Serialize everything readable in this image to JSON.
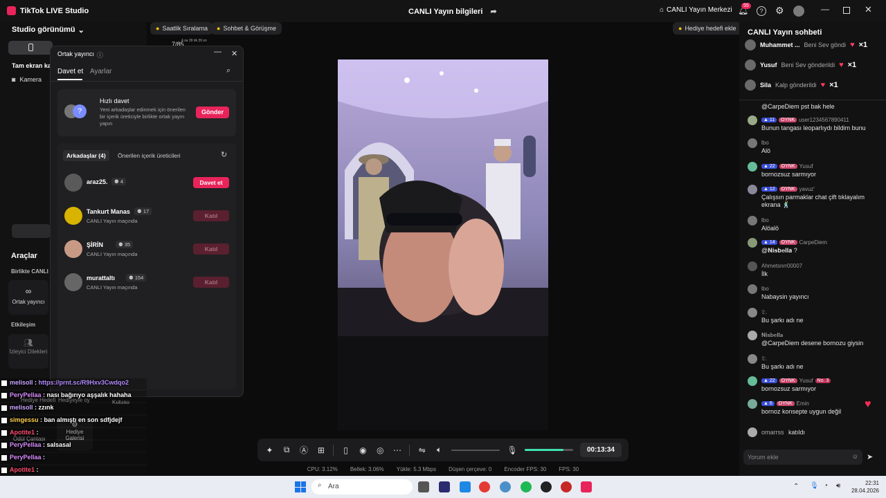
{
  "app": {
    "title": "TikTok LIVE Studio"
  },
  "header": {
    "center_title": "CANLI Yayın bilgileri",
    "live_center": "CANLI Yayın Merkezi",
    "notif_count": "55"
  },
  "left": {
    "view_label": "Studio görünümü",
    "fullscreen_label": "Tam ekran ka",
    "camera_label": "Kamera",
    "tools_title": "Araçlar",
    "together_label": "Birlikte CANLI",
    "cohost_label": "Ortak yayıncı",
    "interaction_label": "Etkileşim",
    "viewer_requests": "İzleyici Dilekleri",
    "tool_gift_goal": "Hediye Hedefi",
    "tool_gift_vote": "Hediyeyle oy",
    "tool_box": "Kutusu",
    "tool_reward_bag": "Ödül Çantası",
    "tool_gift_gallery_1": "Hediye",
    "tool_gift_gallery_2": "Galerisi"
  },
  "stage": {
    "tab_ranking": "Saatlik Sıralama",
    "tab_chat": "Sohbet & Görüşme",
    "counter": "7/85",
    "counter_sub": "4 sa 39 dk 39 sn",
    "gift_goal_button": "Hediye hedefi ekle",
    "timer": "00:13:34",
    "volume_level": 0.8
  },
  "status": {
    "cpu": "CPU:  3.12%",
    "memory": "Bellek:  3.06%",
    "upload": "Yükle:  5.3 Mbps",
    "dropped": "Düşen çerçeve:  0",
    "encoder": "Encoder FPS:  30",
    "fps": "FPS:  30"
  },
  "dialog": {
    "title": "Ortak yayıncı",
    "tab_invite": "Davet et",
    "tab_settings": "Ayarlar",
    "quick_title": "Hızlı davet",
    "quick_desc": "Yeni arkadaşlar edinmek için önerilen bir içerik üreticiyle birlikte ortak yayın yapın",
    "send_button": "Gönder",
    "friends_tab": "Arkadaşlar (4)",
    "suggested_tab": "Önerilen içerik üreticileri",
    "friends": [
      {
        "name": "araz25.",
        "count": "4",
        "sub": "",
        "button": "Davet et"
      },
      {
        "name": "Tankurt Manas",
        "count": "17",
        "sub": "CANLI Yayın maçında",
        "button": "Katıl"
      },
      {
        "name": "ŞİRİN",
        "count": "35",
        "sub": "CANLI Yayın maçında",
        "button": "Katıl"
      },
      {
        "name": "murattaltı",
        "count": "154",
        "sub": "CANLI Yayın maçında",
        "button": "Katıl"
      }
    ]
  },
  "overlay_chat": [
    {
      "user": "melisoll",
      "sep": " : ",
      "text": "https://prnt.sc/R9Hxv3Cwdqo2",
      "ucolor": "#c9a6ff",
      "tcolor": "#b48cff"
    },
    {
      "user": "PeryPellaa",
      "sep": " : ",
      "text": "nası bağırıyo aşşalık hahaha",
      "ucolor": "#d98cff",
      "tcolor": "#ffffff"
    },
    {
      "user": "melisoll",
      "sep": " : ",
      "text": "zzınk",
      "ucolor": "#c9a6ff",
      "tcolor": "#ffffff"
    },
    {
      "user": "simgessu",
      "sep": " : ",
      "text": "ban almıştı en son sdfjdejf",
      "ucolor": "#ffd24d",
      "tcolor": "#ffffff"
    },
    {
      "user": "Apotite1",
      "sep": " : ",
      "text": "",
      "ucolor": "#ff4d6d",
      "tcolor": "#ffffff"
    },
    {
      "user": "PeryPellaa",
      "sep": " : ",
      "text": "salsasal",
      "ucolor": "#d98cff",
      "tcolor": "#ffffff"
    },
    {
      "user": "PeryPellaa",
      "sep": " : ",
      "text": "",
      "ucolor": "#d98cff",
      "tcolor": "#ffffff"
    },
    {
      "user": "Apotite1",
      "sep": " : ",
      "text": "",
      "ucolor": "#ff4d6d",
      "tcolor": "#ffffff"
    }
  ],
  "chat": {
    "title": "CANLI Yayın sohbeti",
    "pinned": [
      {
        "user": "Muhammet ...",
        "action": "Beni Sev göndi",
        "mult": "×1"
      },
      {
        "user": "Yusuf",
        "action": "Beni Sev gönderildi",
        "mult": "×1"
      },
      {
        "user": "Sila",
        "action": "Kalp gönderildi",
        "mult": "×1"
      }
    ],
    "messages": [
      {
        "lvl": "",
        "fan": "",
        "user": "",
        "text": "@CarpeDiem pst bak hele"
      },
      {
        "lvl": "11",
        "fan": "OYNK",
        "user": "user1234567890411",
        "text": "Bunun tangası leoparlıydı bildim bunu"
      },
      {
        "lvl": "",
        "fan": "",
        "user": "lbo",
        "text": "Alö"
      },
      {
        "lvl": "22",
        "fan": "OYNK",
        "user": "Yusuf",
        "text": "bornozsuz sarmıyor"
      },
      {
        "lvl": "12",
        "fan": "OYNK",
        "user": "yavuz'",
        "text": "Çalışsın parmaklar chat çift tıklayalım ekrana 🕺"
      },
      {
        "lvl": "",
        "fan": "",
        "user": "lbo",
        "text": "Alöalö"
      },
      {
        "lvl": "14",
        "fan": "OYNK",
        "user": "CarpeDiem",
        "text": "@𝐍𝐢𝐬𝐛𝐞𝐥𝐥𝐚 ?"
      },
      {
        "lvl": "",
        "fan": "",
        "user": "Ahmetsnrr00007",
        "text": "İlk"
      },
      {
        "lvl": "",
        "fan": "",
        "user": "lbo",
        "text": "Nabaysin yayıncı"
      },
      {
        "lvl": "",
        "fan": "",
        "user": "𝔇.",
        "text": "Bu şarkı adı ne"
      },
      {
        "lvl": "",
        "fan": "",
        "user": "𝐍𝐢𝐬𝐛𝐞𝐥𝐥𝐚",
        "text": "@CarpeDiem desene bornozu giysin"
      },
      {
        "lvl": "",
        "fan": "",
        "user": "𝔇.",
        "text": "Bu şarkı adı ne"
      },
      {
        "lvl": "22",
        "fan": "OYNK",
        "user": "Yusuf",
        "text": "bornozsuz sarmıyor",
        "no": "No. 3"
      },
      {
        "lvl": "6",
        "fan": "OYNK",
        "user": "Emin",
        "text": "bornoz konsepte uygun değil"
      }
    ],
    "joined_user": "omarrss",
    "joined_text": "katıldı",
    "comment_placeholder": "Yorum ekle"
  },
  "taskbar": {
    "search": "Ara",
    "time": "22:31",
    "date": "28.04.2026"
  },
  "colors": {
    "accent": "#e8245a",
    "bg": "#0f0f10",
    "panel": "#121213"
  }
}
